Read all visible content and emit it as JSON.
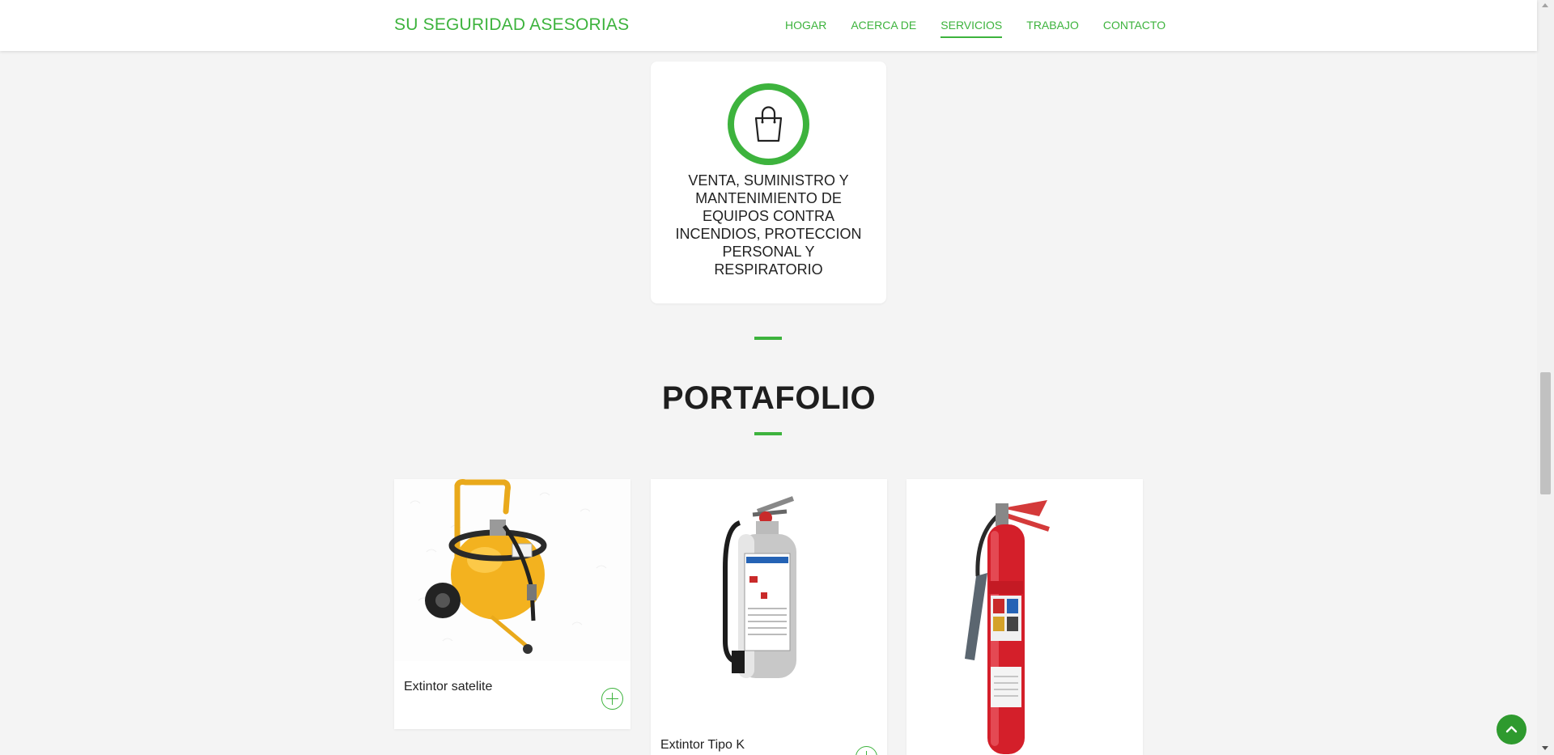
{
  "nav": {
    "brand": "SU SEGURIDAD ASESORIAS",
    "items": [
      {
        "label": "HOGAR"
      },
      {
        "label": "ACERCA DE"
      },
      {
        "label": "SERVICIOS",
        "active": true
      },
      {
        "label": "TRABAJO"
      },
      {
        "label": "CONTACTO"
      }
    ]
  },
  "service": {
    "icon": "shopping-bag-icon",
    "title": "VENTA, SUMINISTRO Y MANTENIMIENTO DE EQUIPOS CONTRA INCENDIOS, PROTECCION PERSONAL Y RESPIRATORIO"
  },
  "portfolio": {
    "heading": "PORTAFOLIO",
    "items": [
      {
        "title": "Extintor satelite",
        "image": "yellow-wheeled-extinguisher"
      },
      {
        "title": "Extintor Tipo K",
        "image": "stainless-extinguisher"
      },
      {
        "title": "",
        "image": "red-co2-extinguisher"
      }
    ]
  },
  "colors": {
    "accent": "#3db33d",
    "background": "#f4f4f4",
    "back_to_top": "#2e9a2e"
  }
}
